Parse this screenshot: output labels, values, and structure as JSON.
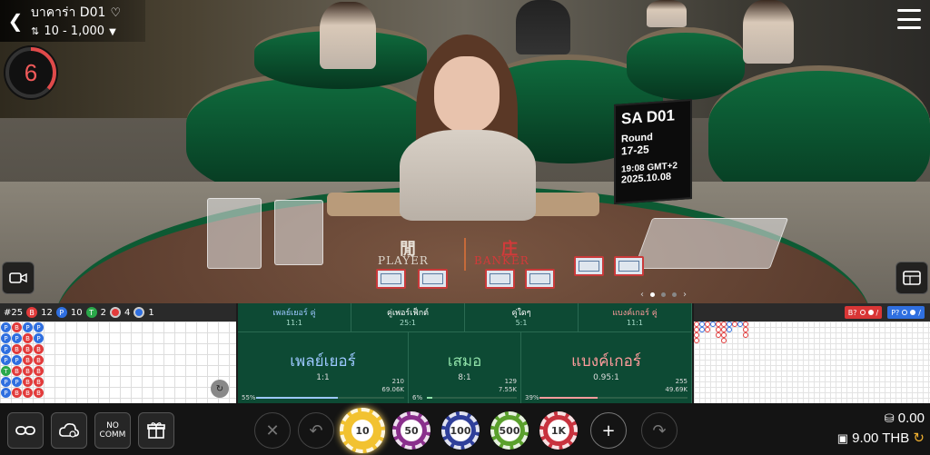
{
  "topbar": {
    "table_title": "บาคาร่า D01",
    "bet_limit": "10 - 1,000"
  },
  "timer": {
    "value": "6"
  },
  "round_card": {
    "logo": "SA D01",
    "round_label": "Round",
    "round_number": "17-25",
    "time": "19:08 GMT+2",
    "date": "2025.10.08"
  },
  "table_labels": {
    "player_char": "閒",
    "player": "PLAYER",
    "banker_char": "庄",
    "banker": "BANKER"
  },
  "stats": {
    "round": "#25",
    "banker": {
      "label": "B",
      "value": "12"
    },
    "player": {
      "label": "P",
      "value": "10"
    },
    "tie": {
      "label": "T",
      "value": "2"
    },
    "banker_pair": {
      "value": "4"
    },
    "player_pair": {
      "value": "1"
    }
  },
  "bead_road": [
    [
      "P",
      "P",
      "P",
      "P",
      "T",
      "P",
      "P"
    ],
    [
      "B",
      "P",
      "B",
      "P",
      "B",
      "P",
      "B"
    ],
    [
      "P",
      "B",
      "B",
      "B",
      "B",
      "B",
      "B"
    ],
    [
      "P",
      "P",
      "B",
      "B",
      "B",
      "B",
      "B"
    ]
  ],
  "side_bets": [
    {
      "name": "เพลย์เยอร์ คู่",
      "odds": "11:1"
    },
    {
      "name": "คู่เพอร์เฟ็กต์",
      "odds": "25:1"
    },
    {
      "name": "คู่ใดๆ",
      "odds": "5:1"
    },
    {
      "name": "แบงค์เกอร์ คู่",
      "odds": "11:1"
    }
  ],
  "main_bets": [
    {
      "name": "เพลย์เยอร์",
      "odds": "1:1",
      "players": "210",
      "amount": "69.06K",
      "percent": "55%",
      "color": "#9cc8ff",
      "fill": 0.55
    },
    {
      "name": "เสมอ",
      "odds": "8:1",
      "players": "129",
      "amount": "7.55K",
      "percent": "6%",
      "color": "#8fe0a8",
      "fill": 0.06
    },
    {
      "name": "แบงค์เกอร์",
      "odds": "0.95:1",
      "players": "255",
      "amount": "49.69K",
      "percent": "39%",
      "color": "#ff9c9c",
      "fill": 0.39
    }
  ],
  "ask_road": {
    "banker_label": "B?",
    "player_label": "P?"
  },
  "tools": {
    "no_comm_label": "NO\nCOMM"
  },
  "chips": [
    {
      "value": "10",
      "color": "#f2c230"
    },
    {
      "value": "50",
      "color": "#8a2f8c"
    },
    {
      "value": "100",
      "color": "#2f3f9a"
    },
    {
      "value": "500",
      "color": "#5aa02c"
    },
    {
      "value": "1K",
      "color": "#c8323e"
    }
  ],
  "balance": {
    "bet_amount": "0.00",
    "wallet": "9.00 THB"
  },
  "colors": {
    "banker": "#e23b3b",
    "player": "#2f6fe0",
    "tie": "#2aa84a",
    "felt": "#0d4a34"
  }
}
